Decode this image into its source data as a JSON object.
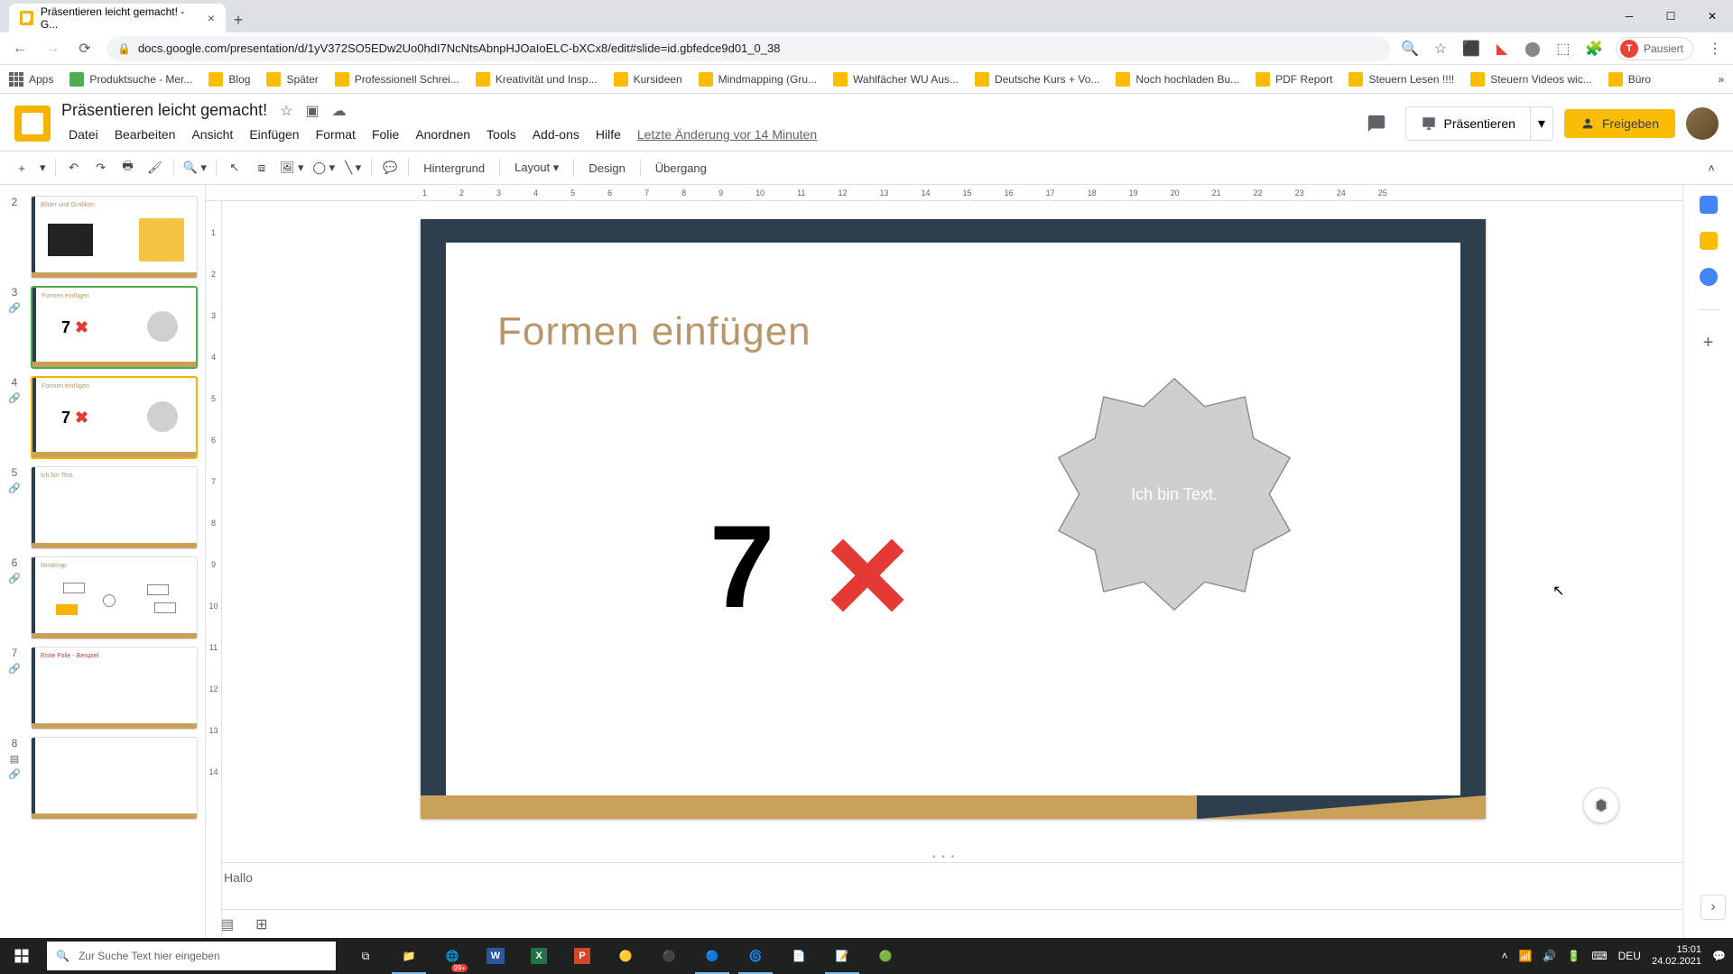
{
  "browser": {
    "tab_title": "Präsentieren leicht gemacht! - G...",
    "url": "docs.google.com/presentation/d/1yV372SO5EDw2Uo0hdI7NcNtsAbnpHJOaIoELC-bXCx8/edit#slide=id.gbfedce9d01_0_38",
    "profile_status": "Pausiert",
    "profile_initial": "T"
  },
  "bookmarks": [
    "Apps",
    "Produktsuche - Mer...",
    "Blog",
    "Später",
    "Professionell Schrei...",
    "Kreativität und Insp...",
    "Kursideen",
    "Mindmapping  (Gru...",
    "Wahlfächer WU Aus...",
    "Deutsche Kurs + Vo...",
    "Noch hochladen Bu...",
    "PDF Report",
    "Steuern Lesen !!!!",
    "Steuern Videos wic...",
    "Büro"
  ],
  "doc": {
    "title": "Präsentieren leicht gemacht!",
    "last_edit": "Letzte Änderung vor 14 Minuten"
  },
  "menus": [
    "Datei",
    "Bearbeiten",
    "Ansicht",
    "Einfügen",
    "Format",
    "Folie",
    "Anordnen",
    "Tools",
    "Add-ons",
    "Hilfe"
  ],
  "header_buttons": {
    "present": "Präsentieren",
    "share": "Freigeben"
  },
  "toolbar": {
    "background": "Hintergrund",
    "layout": "Layout",
    "design": "Design",
    "transition": "Übergang"
  },
  "ruler_h": [
    "1",
    "2",
    "3",
    "4",
    "5",
    "6",
    "7",
    "8",
    "9",
    "10",
    "11",
    "12",
    "13",
    "14",
    "15",
    "16",
    "17",
    "18",
    "19",
    "20",
    "21",
    "22",
    "23",
    "24",
    "25"
  ],
  "ruler_v": [
    "1",
    "2",
    "3",
    "4",
    "5",
    "6",
    "7",
    "8",
    "9",
    "10",
    "11",
    "12",
    "13",
    "14"
  ],
  "slide": {
    "title": "Formen einfügen",
    "seven": "7",
    "star_text": "Ich bin Text."
  },
  "thumbs": [
    {
      "num": "2",
      "title": "Bilder und Grafiken"
    },
    {
      "num": "3",
      "title": "Formen einfügen"
    },
    {
      "num": "4",
      "title": "Formen einfügen"
    },
    {
      "num": "5",
      "title": "Ich bin Text."
    },
    {
      "num": "6",
      "title": "Mindmap"
    },
    {
      "num": "7",
      "title": "Erste Folie - Beispiel"
    },
    {
      "num": "8",
      "title": ""
    }
  ],
  "notes": "Hallo",
  "taskbar": {
    "search_placeholder": "Zur Suche Text hier eingeben",
    "lang": "DEU",
    "time": "15:01",
    "date": "24.02.2021",
    "badge": "99+"
  }
}
